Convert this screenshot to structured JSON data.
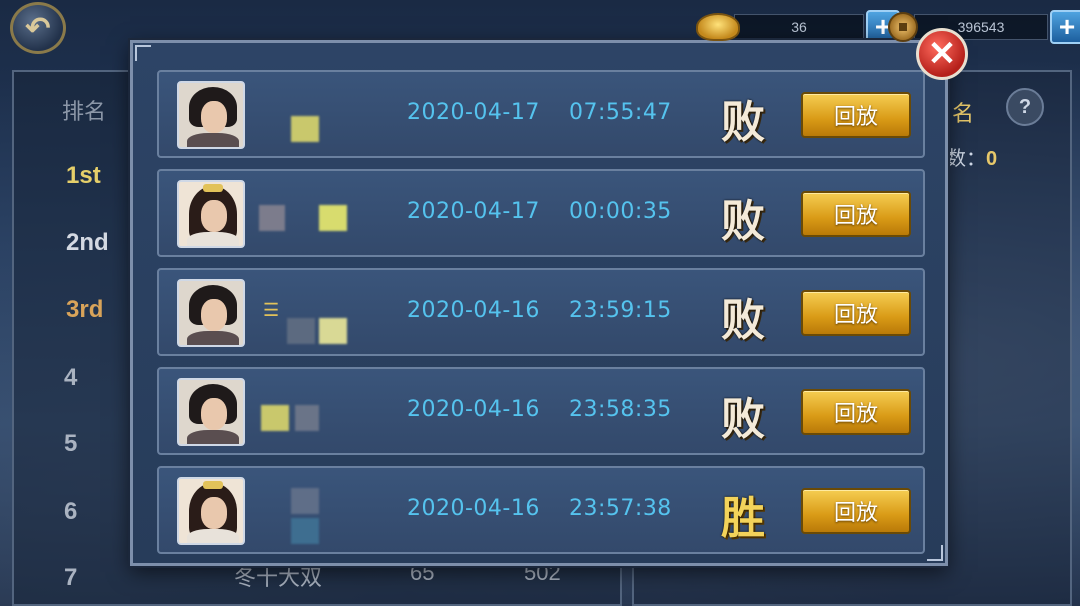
{
  "topbar": {
    "back_icon": "back-arrow-icon",
    "ingot_amount": "36",
    "coin_amount": "396543",
    "plus_label": "+"
  },
  "left_panel": {
    "header": "排名",
    "ranks": [
      "1st",
      "2nd",
      "3rd",
      "4",
      "5",
      "6",
      "7"
    ],
    "bottom_row": {
      "name": "冬十大双",
      "score1": "65",
      "score2": "502"
    }
  },
  "right_panel": {
    "header": "名",
    "help_label": "?",
    "count_label": "数：",
    "count_value": "0"
  },
  "modal": {
    "close_label": "✕",
    "records": [
      {
        "avatar": "male",
        "date": "2020-04-17",
        "time": "07:55:47",
        "result": "败",
        "replay_label": "回放",
        "blur_colors": [
          "#c9c86c",
          "#4a5a6a",
          "#2e6e86"
        ]
      },
      {
        "avatar": "female",
        "date": "2020-04-17",
        "time": "00:00:35",
        "result": "败",
        "replay_label": "回放",
        "blur_colors": [
          "#7c7c8c",
          "#d8dc6e"
        ]
      },
      {
        "avatar": "male",
        "date": "2020-04-16",
        "time": "23:59:15",
        "result": "败",
        "replay_label": "回放",
        "blur_colors": [
          "#5c6a80",
          "#d9d995",
          "#7e8aa6"
        ]
      },
      {
        "avatar": "male",
        "date": "2020-04-16",
        "time": "23:58:35",
        "result": "败",
        "replay_label": "回放",
        "blur_colors": [
          "#c9c86c",
          "#6a7488"
        ]
      },
      {
        "avatar": "female",
        "date": "2020-04-16",
        "time": "23:57:38",
        "result": "胜",
        "replay_label": "回放",
        "blur_colors": [
          "#5f6e88",
          "#3e6e90"
        ]
      }
    ]
  }
}
